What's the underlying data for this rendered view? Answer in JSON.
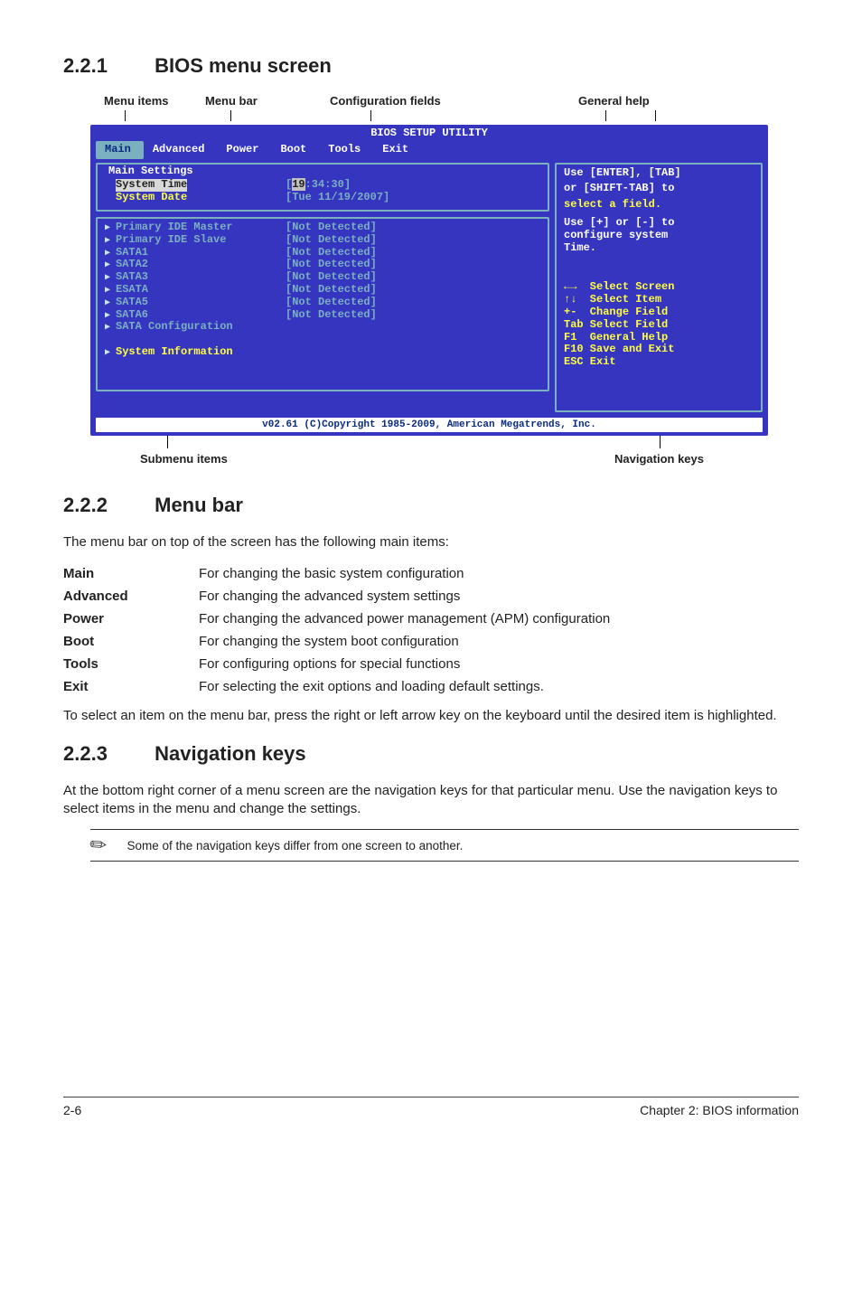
{
  "sections": {
    "s221": {
      "num": "2.2.1",
      "title": "BIOS menu screen"
    },
    "s222": {
      "num": "2.2.2",
      "title": "Menu bar"
    },
    "s223": {
      "num": "2.2.3",
      "title": "Navigation keys"
    }
  },
  "top_labels": {
    "menu_items": "Menu items",
    "menu_bar": "Menu bar",
    "config_fields": "Configuration fields",
    "general_help": "General help"
  },
  "bottom_labels": {
    "submenu": "Submenu items",
    "navkeys": "Navigation keys"
  },
  "bios": {
    "title": "BIOS SETUP UTILITY",
    "menu": [
      "Main",
      "Advanced",
      "Power",
      "Boot",
      "Tools",
      "Exit"
    ],
    "main_settings_header": "Main Settings",
    "rows": {
      "system_time_label": "System Time",
      "system_time_value_pre": "[",
      "system_time_value_hh": "19",
      "system_time_value_rest": ":34:30]",
      "system_date_label": "System Date",
      "system_date_value": "[Tue 11/19/2007]",
      "pim": "Primary IDE Master",
      "pis": "Primary IDE Slave",
      "sata1": "SATA1",
      "sata2": "SATA2",
      "sata3": "SATA3",
      "esata": "ESATA",
      "sata5": "SATA5",
      "sata6": "SATA6",
      "sata_cfg": "SATA Configuration",
      "sysinfo": "System Information",
      "nd": "[Not Detected]"
    },
    "help_top_l1": "Use [ENTER], [TAB]",
    "help_top_l2": "or [SHIFT-TAB] to",
    "help_top_l3": "select a field.",
    "help_mid_l1": "Use [+] or [-] to",
    "help_mid_l2": "configure system",
    "help_mid_l3": "Time.",
    "nav": [
      {
        "sym": "←→",
        "txt": "  Select Screen"
      },
      {
        "sym": "↑↓",
        "txt": "  Select Item"
      },
      {
        "sym": "+-",
        "txt": "  Change Field"
      },
      {
        "sym": "Tab",
        "txt": " Select Field"
      },
      {
        "sym": "F1",
        "txt": "  General Help"
      },
      {
        "sym": "F10",
        "txt": " Save and Exit"
      },
      {
        "sym": "ESC",
        "txt": " Exit"
      }
    ],
    "footer": "v02.61 (C)Copyright 1985-2009, American Megatrends, Inc."
  },
  "s222_intro": "The menu bar on top of the screen has the following main items:",
  "defs": [
    {
      "k": "Main",
      "v": "For changing the basic system configuration"
    },
    {
      "k": "Advanced",
      "v": "For changing the advanced system settings"
    },
    {
      "k": "Power",
      "v": "For changing the advanced power management (APM) configuration"
    },
    {
      "k": "Boot",
      "v": "For changing the system boot configuration"
    },
    {
      "k": "Tools",
      "v": "For configuring options for special functions"
    },
    {
      "k": "Exit",
      "v": "For selecting the exit options and loading default settings."
    }
  ],
  "s222_outro": "To select an item on the menu bar, press the right or left arrow key on the keyboard until the desired item is highlighted.",
  "s223_p1": "At the bottom right corner of a menu screen are the navigation keys for that particular menu. Use the navigation keys to select items in the menu and change the settings.",
  "note": "Some of the navigation keys differ from one screen to another.",
  "footer_left": "2-6",
  "footer_right": "Chapter 2: BIOS information"
}
